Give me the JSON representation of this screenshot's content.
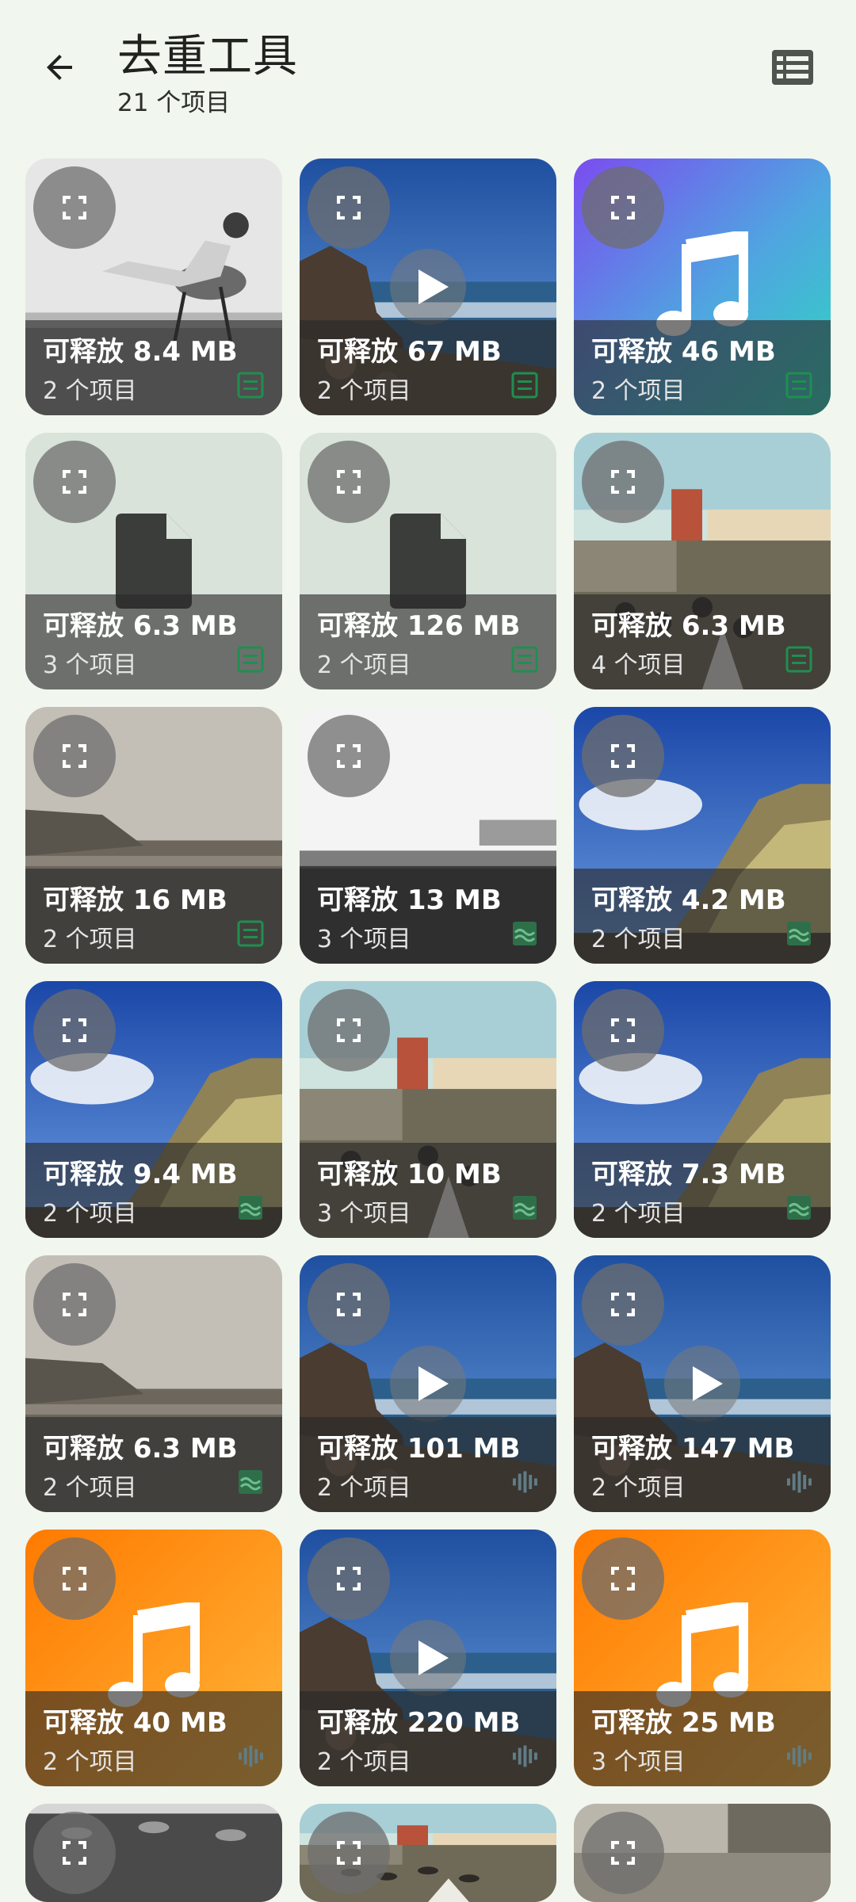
{
  "header": {
    "title": "去重工具",
    "subtitle": "21 个项目"
  },
  "tiles": [
    {
      "size": "可释放 8.4 MB",
      "count": "2 个项目",
      "thumb": "photo-bw-woman",
      "center": "",
      "type": "doc"
    },
    {
      "size": "可释放 67 MB",
      "count": "2 个项目",
      "thumb": "video-coast",
      "center": "play",
      "type": "doc"
    },
    {
      "size": "可释放 46 MB",
      "count": "2 个项目",
      "thumb": "gradient-purple-teal",
      "center": "music",
      "type": "doc"
    },
    {
      "size": "可释放 6.3 MB",
      "count": "3 个项目",
      "thumb": "file-blank",
      "center": "file",
      "type": "doc"
    },
    {
      "size": "可释放 126 MB",
      "count": "2 个项目",
      "thumb": "file-blank",
      "center": "file",
      "type": "doc"
    },
    {
      "size": "可释放 6.3 MB",
      "count": "4 个项目",
      "thumb": "postcard-pier",
      "center": "",
      "type": "doc"
    },
    {
      "size": "可释放 16 MB",
      "count": "2 个项目",
      "thumb": "sepia-beach",
      "center": "",
      "type": "doc"
    },
    {
      "size": "可释放 13 MB",
      "count": "3 个项目",
      "thumb": "bw-crowd",
      "center": "",
      "type": "image"
    },
    {
      "size": "可释放 4.2 MB",
      "count": "2 个项目",
      "thumb": "cliff-sky",
      "center": "",
      "type": "image"
    },
    {
      "size": "可释放 9.4 MB",
      "count": "2 个项目",
      "thumb": "cliff-sky",
      "center": "",
      "type": "image"
    },
    {
      "size": "可释放 10 MB",
      "count": "3 个项目",
      "thumb": "postcard-pier",
      "center": "",
      "type": "image"
    },
    {
      "size": "可释放 7.3 MB",
      "count": "2 个项目",
      "thumb": "cliff-sky",
      "center": "",
      "type": "image"
    },
    {
      "size": "可释放 6.3 MB",
      "count": "2 个项目",
      "thumb": "sepia-beach",
      "center": "",
      "type": "image"
    },
    {
      "size": "可释放 101 MB",
      "count": "2 个项目",
      "thumb": "video-coast",
      "center": "play",
      "type": "audio"
    },
    {
      "size": "可释放 147 MB",
      "count": "2 个项目",
      "thumb": "video-coast",
      "center": "play",
      "type": "audio"
    },
    {
      "size": "可释放 40 MB",
      "count": "2 个项目",
      "thumb": "gradient-orange",
      "center": "music",
      "type": "audio"
    },
    {
      "size": "可释放 220 MB",
      "count": "2 个项目",
      "thumb": "video-coast",
      "center": "play",
      "type": "audio"
    },
    {
      "size": "可释放 25 MB",
      "count": "3 个项目",
      "thumb": "gradient-orange",
      "center": "music",
      "type": "audio"
    }
  ],
  "partial_tiles": [
    {
      "thumb": "bw-crowd-beach"
    },
    {
      "thumb": "postcard-pier"
    },
    {
      "thumb": "sepia-promenade"
    }
  ],
  "colors": {
    "background": "#f1f6ee",
    "type_icon": "#1f8f4f",
    "overlay": "#282828"
  }
}
